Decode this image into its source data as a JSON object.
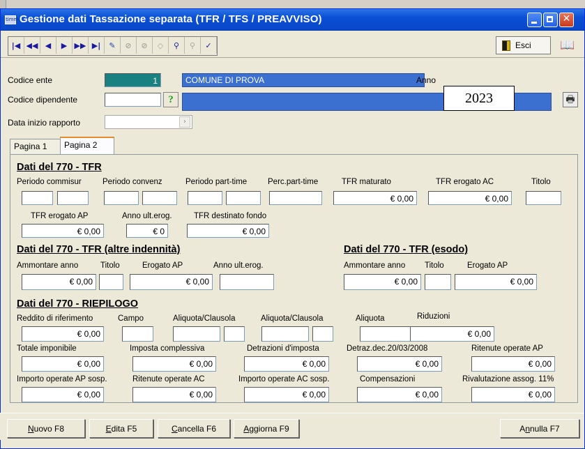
{
  "window": {
    "title": "Gestione dati Tassazione separata (TFR / TFS / PREAVVISO)",
    "app_icon_text": "timm"
  },
  "toolbar": {
    "nav": [
      "|◀",
      "◀◀",
      "◀",
      "▶",
      "▶▶",
      "▶|",
      "✎",
      "⊘",
      "⊘",
      "◇",
      "⚲",
      "⚲",
      "✓"
    ],
    "esci_label": "Esci"
  },
  "header": {
    "codice_ente_label": "Codice ente",
    "codice_ente_value": "1",
    "ente_name": "COMUNE DI PROVA",
    "anno_label": "Anno",
    "anno_value": "2023",
    "codice_dipendente_label": "Codice dipendente",
    "codice_dipendente_value": "",
    "help_symbol": "?",
    "data_inizio_label": "Data inizio rapporto",
    "data_inizio_value": ""
  },
  "tabs": [
    {
      "label": "Pagina 1"
    },
    {
      "label": "Pagina 2"
    }
  ],
  "section_tfr": {
    "title": "Dati del 770 - TFR",
    "labels": {
      "periodo_commisur": "Periodo commisur",
      "periodo_convenz": "Periodo convenz",
      "periodo_part_time": "Periodo part-time",
      "perc_part_time": "Perc.part-time",
      "tfr_maturato": "TFR maturato",
      "tfr_erogato_ac": "TFR erogato AC",
      "titolo": "Titolo",
      "tfr_erogato_ap": "TFR erogato AP",
      "anno_ult_erog": "Anno ult.erog.",
      "tfr_destinato_fondo": "TFR destinato fondo"
    },
    "values": {
      "tfr_maturato": "€ 0,00",
      "tfr_erogato_ac": "€ 0,00",
      "tfr_erogato_ap": "€ 0,00",
      "anno_ult_erog": "€ 0",
      "tfr_destinato_fondo": "€ 0,00"
    }
  },
  "section_altre": {
    "title": "Dati del 770 - TFR (altre indennità)",
    "labels": {
      "ammontare": "Ammontare anno",
      "titolo": "Titolo",
      "erogato_ap": "Erogato AP",
      "anno_ult": "Anno ult.erog."
    },
    "values": {
      "ammontare": "€ 0,00",
      "erogato_ap": "€ 0,00"
    }
  },
  "section_esodo": {
    "title": "Dati del 770 - TFR (esodo)",
    "labels": {
      "ammontare": "Ammontare anno",
      "titolo": "Titolo",
      "erogato_ap": "Erogato AP"
    },
    "values": {
      "ammontare": "€ 0,00",
      "erogato_ap": "€ 0,00"
    }
  },
  "section_riepilogo": {
    "title": "Dati del 770 - RIEPILOGO",
    "labels": {
      "reddito": "Reddito di riferimento",
      "campo": "Campo",
      "aliquota_clausola_1": "Aliquota/Clausola",
      "aliquota_clausola_2": "Aliquota/Clausola",
      "aliquota": "Aliquota",
      "riduzioni": "Riduzioni",
      "totale_imponibile": "Totale imponibile",
      "imposta_complessiva": "Imposta complessiva",
      "detrazioni": "Detrazioni d'imposta",
      "detraz_dec": "Detraz.dec.20/03/2008",
      "ritenute_ap": "Ritenute operate AP",
      "importo_ap_sosp": "Importo operate AP sosp.",
      "ritenute_ac": "Ritenute operate AC",
      "importo_ac_sosp": "Importo operate AC sosp.",
      "compensazioni": "Compensazioni",
      "rivalutazione": "Rivalutazione assog. 11%"
    },
    "values": {
      "reddito": "€ 0,00",
      "riduzioni": "€ 0,00",
      "totale_imponibile": "€ 0,00",
      "imposta_complessiva": "€ 0,00",
      "detrazioni": "€ 0,00",
      "detraz_dec": "€ 0,00",
      "ritenute_ap": "€ 0,00",
      "importo_ap_sosp": "€ 0,00",
      "ritenute_ac": "€ 0,00",
      "importo_ac_sosp": "€ 0,00",
      "compensazioni": "€ 0,00",
      "rivalutazione": "€ 0,00"
    }
  },
  "buttons": {
    "nuovo": {
      "hot": "N",
      "rest": "uovo F8"
    },
    "edita": {
      "hot": "E",
      "rest": "dita F5"
    },
    "cancella": {
      "hot": "C",
      "rest": "ancella F6"
    },
    "aggiorna": {
      "hot": "A",
      "rest": "ggiorna F9"
    },
    "annulla": {
      "pre": "A",
      "hot": "n",
      "rest": "nulla F7"
    }
  }
}
